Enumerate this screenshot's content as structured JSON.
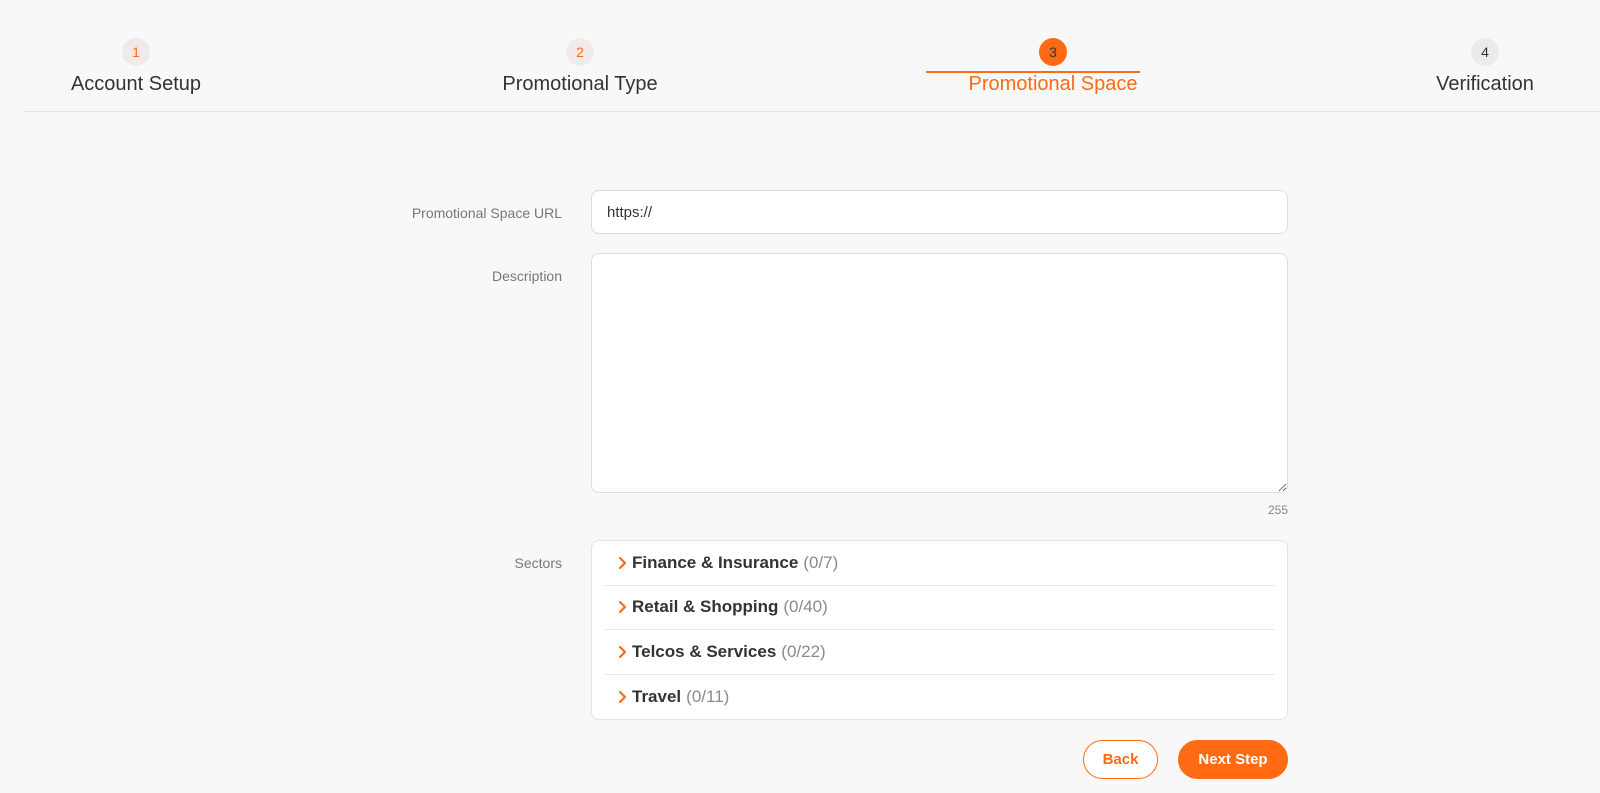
{
  "colors": {
    "accent": "#ff6a13",
    "background": "#f8f8f8",
    "text": "#333333",
    "muted": "#777777"
  },
  "stepper": {
    "steps": [
      {
        "number": "1",
        "label": "Account Setup",
        "state": "done"
      },
      {
        "number": "2",
        "label": "Promotional Type",
        "state": "done"
      },
      {
        "number": "3",
        "label": "Promotional Space",
        "state": "active"
      },
      {
        "number": "4",
        "label": "Verification",
        "state": "todo"
      }
    ]
  },
  "form": {
    "url": {
      "label": "Promotional Space URL",
      "value": "https://"
    },
    "description": {
      "label": "Description",
      "value": "",
      "char_count": "255"
    },
    "sectors": {
      "label": "Sectors",
      "items": [
        {
          "name": "Finance & Insurance",
          "count": "(0/7)",
          "icon": "chevron-right-icon"
        },
        {
          "name": "Retail & Shopping",
          "count": "(0/40)",
          "icon": "chevron-right-icon"
        },
        {
          "name": "Telcos & Services",
          "count": "(0/22)",
          "icon": "chevron-right-icon"
        },
        {
          "name": "Travel",
          "count": "(0/11)",
          "icon": "chevron-right-icon"
        }
      ]
    }
  },
  "actions": {
    "back_label": "Back",
    "next_label": "Next Step"
  }
}
